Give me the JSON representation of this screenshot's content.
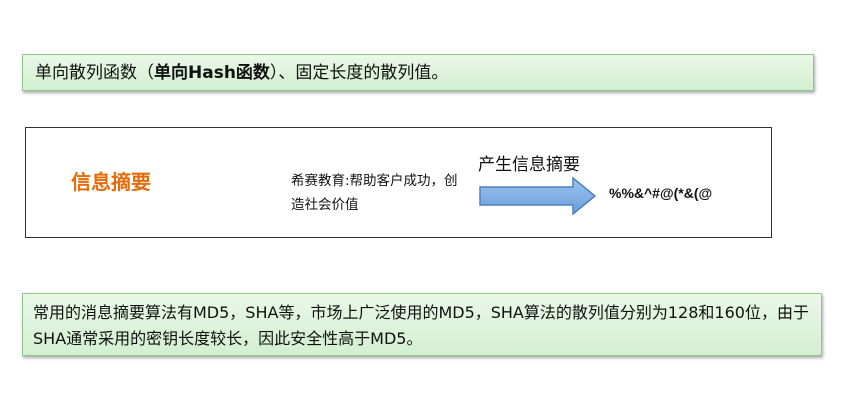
{
  "top_box": {
    "prefix": "单向散列函数（",
    "bold": "单向Hash函数",
    "suffix": "）、固定长度的散列值。"
  },
  "diagram": {
    "title": "信息摘要",
    "input_text": "希赛教育:帮助客户成功，创造社会价值",
    "arrow_label": "产生信息摘要",
    "output": "%%&^#@(*&(@",
    "arrow_color": "#4f81bd",
    "title_color": "#e46c0a"
  },
  "bottom_box": {
    "text": "常用的消息摘要算法有MD5，SHA等，市场上广泛使用的MD5，SHA算法的散列值分别为128和160位，由于SHA通常采用的密钥长度较长，因此安全性高于MD5。"
  }
}
